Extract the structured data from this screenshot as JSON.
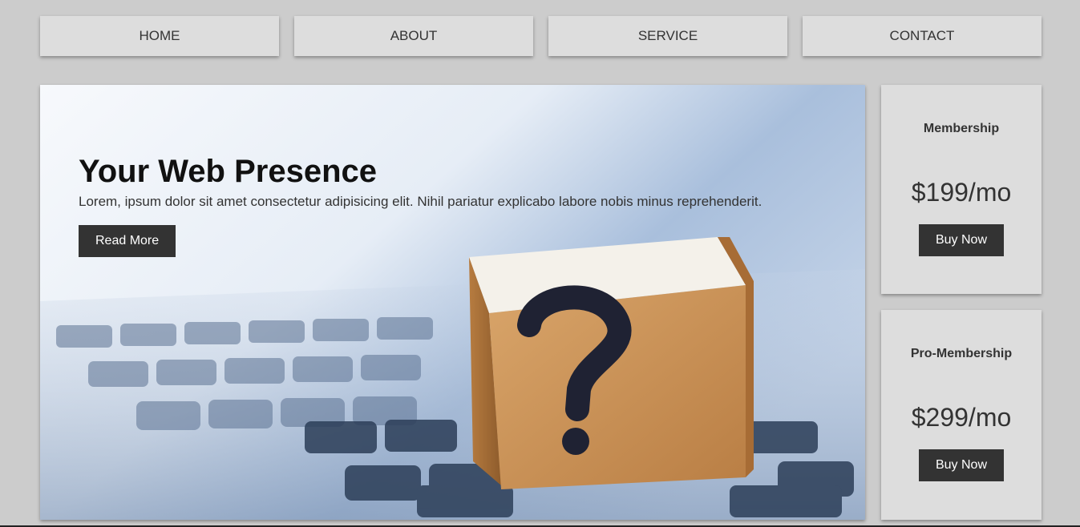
{
  "nav": {
    "items": [
      {
        "label": "HOME"
      },
      {
        "label": "ABOUT"
      },
      {
        "label": "SERVICE"
      },
      {
        "label": "CONTACT"
      }
    ]
  },
  "hero": {
    "title": "Your Web Presence",
    "text": "Lorem, ipsum dolor sit amet consectetur adipisicing elit. Nihil pariatur explicabo labore nobis minus reprehenderit.",
    "button_label": "Read More",
    "image": "keyboard with wooden question mark cube"
  },
  "plans": [
    {
      "name": "Membership",
      "price": "$199/mo",
      "button_label": "Buy Now"
    },
    {
      "name": "Pro-Membership",
      "price": "$299/mo",
      "button_label": "Buy Now"
    }
  ],
  "colors": {
    "page_bg": "#cccccc",
    "panel_bg": "#dddddd",
    "button_bg": "#333333",
    "button_text": "#ffffff"
  }
}
